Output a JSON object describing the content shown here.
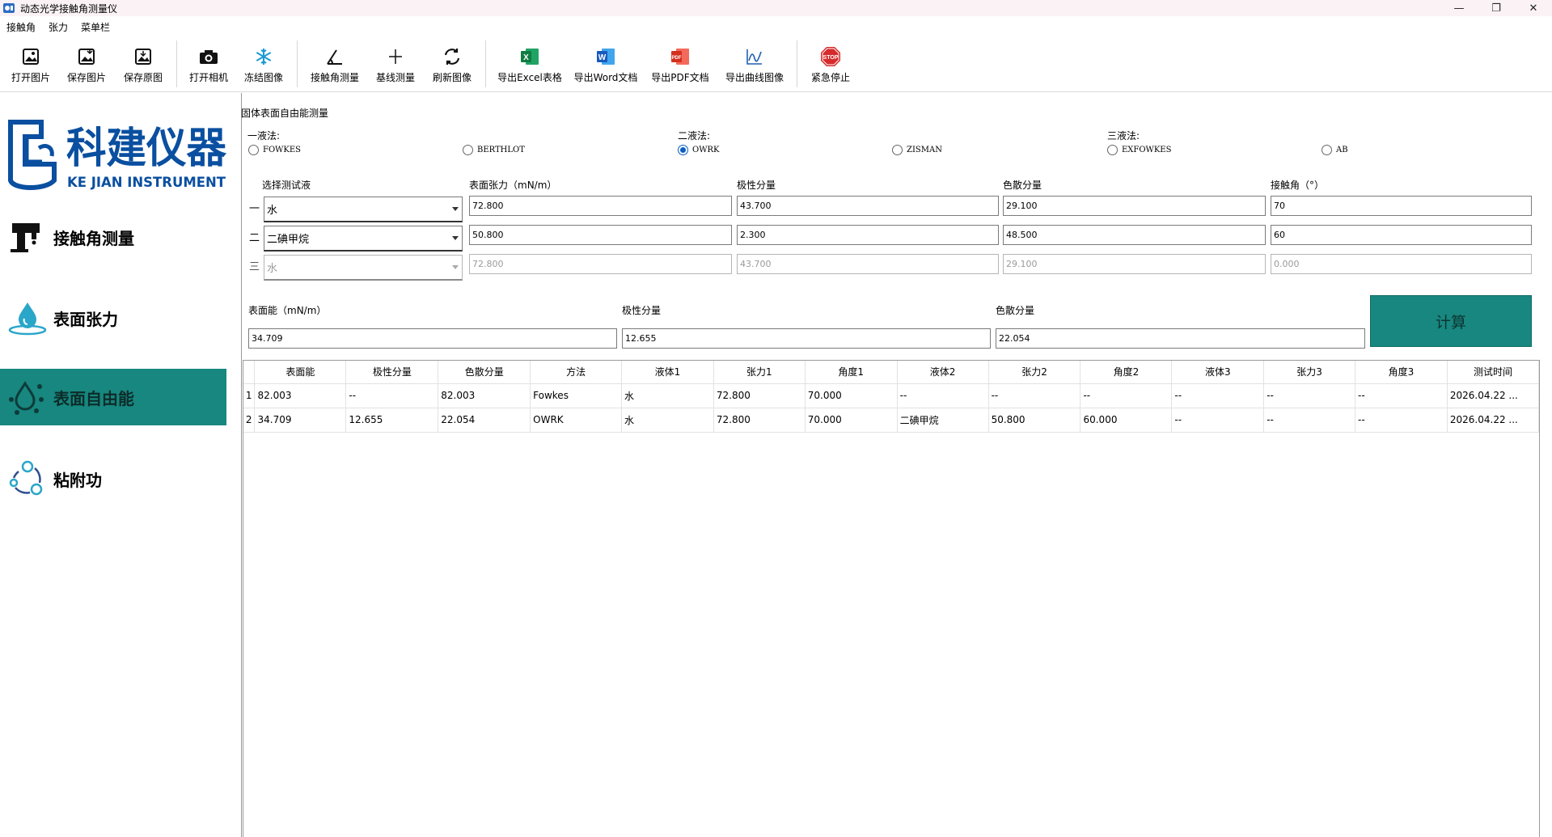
{
  "window": {
    "title": "动态光学接触角测量仪"
  },
  "menu": [
    "接触角",
    "张力",
    "菜单栏"
  ],
  "toolbar": [
    {
      "label": "打开图片",
      "icon": "open-image-icon"
    },
    {
      "label": "保存图片",
      "icon": "save-image-icon"
    },
    {
      "label": "保存原图",
      "icon": "save-original-icon"
    },
    {
      "label": "打开相机",
      "icon": "camera-icon"
    },
    {
      "label": "冻结图像",
      "icon": "freeze-icon"
    },
    {
      "label": "接触角测量",
      "icon": "angle-icon"
    },
    {
      "label": "基线测量",
      "icon": "baseline-icon"
    },
    {
      "label": "刷新图像",
      "icon": "refresh-icon"
    },
    {
      "label": "导出Excel表格",
      "icon": "excel-icon"
    },
    {
      "label": "导出Word文档",
      "icon": "word-icon"
    },
    {
      "label": "导出PDF文档",
      "icon": "pdf-icon"
    },
    {
      "label": "导出曲线图像",
      "icon": "curve-icon"
    },
    {
      "label": "紧急停止",
      "icon": "stop-icon"
    }
  ],
  "logo": {
    "cn": "科建仪器",
    "en": "KE JIAN INSTRUMENT"
  },
  "nav": [
    {
      "label": "接触角测量",
      "active": false
    },
    {
      "label": "表面张力",
      "active": false
    },
    {
      "label": "表面自由能",
      "active": true
    },
    {
      "label": "粘附功",
      "active": false
    }
  ],
  "main": {
    "section_title": "固体表面自由能测量",
    "groups": [
      "一液法:",
      "二液法:",
      "三液法:"
    ],
    "methods": [
      {
        "label": "FOWKES",
        "checked": false
      },
      {
        "label": "BERTHLOT",
        "checked": false
      },
      {
        "label": "OWRK",
        "checked": true
      },
      {
        "label": "ZISMAN",
        "checked": false
      },
      {
        "label": "EXFOWKES",
        "checked": false
      },
      {
        "label": "AB",
        "checked": false
      }
    ],
    "columns": [
      "选择测试液",
      "表面张力（mN/m）",
      "极性分量",
      "色散分量",
      "接触角（°）"
    ],
    "rows": [
      {
        "idx": "一",
        "liquid": "水",
        "tension": "72.800",
        "polar": "43.700",
        "disp": "29.100",
        "angle": "70",
        "enabled": true
      },
      {
        "idx": "二",
        "liquid": "二碘甲烷",
        "tension": "50.800",
        "polar": "2.300",
        "disp": "48.500",
        "angle": "60",
        "enabled": true
      },
      {
        "idx": "三",
        "liquid": "水",
        "tension": "72.800",
        "polar": "43.700",
        "disp": "29.100",
        "angle": "0.000",
        "enabled": false
      }
    ],
    "results": {
      "energy_label": "表面能（mN/m）",
      "energy": "34.709",
      "polar_label": "极性分量",
      "polar": "12.655",
      "disp_label": "色散分量",
      "disp": "22.054"
    },
    "calc_label": "计算"
  },
  "table": {
    "headers": [
      "表面能",
      "极性分量",
      "色散分量",
      "方法",
      "液体1",
      "张力1",
      "角度1",
      "液体2",
      "张力2",
      "角度2",
      "液体3",
      "张力3",
      "角度3",
      "测试时间"
    ],
    "rows": [
      [
        "1",
        "82.003",
        "--",
        "82.003",
        "Fowkes",
        "水",
        "72.800",
        "70.000",
        "--",
        "--",
        "--",
        "--",
        "--",
        "--",
        "2026.04.22 ..."
      ],
      [
        "2",
        "34.709",
        "12.655",
        "22.054",
        "OWRK",
        "水",
        "72.800",
        "70.000",
        "二碘甲烷",
        "50.800",
        "60.000",
        "--",
        "--",
        "--",
        "2026.04.22 ..."
      ]
    ]
  },
  "colors": {
    "accent": "#17877f",
    "brand": "#0a4fa0"
  }
}
